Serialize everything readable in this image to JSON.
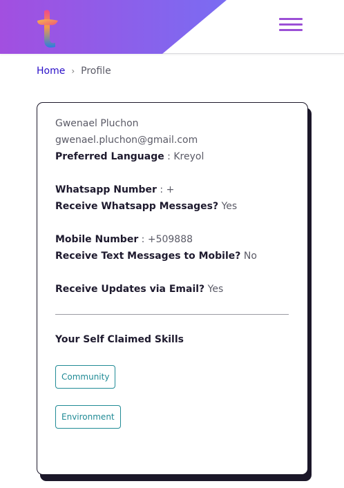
{
  "header": {
    "logo_icon": "t-logo-icon",
    "menu_icon": "hamburger-menu-icon",
    "gradient_from": "#a24fe0",
    "gradient_to": "#7a6cf2",
    "menu_color": "#9b4fd6"
  },
  "breadcrumb": {
    "home": "Home",
    "separator": "›",
    "current": "Profile"
  },
  "profile": {
    "name": "Gwenael Pluchon",
    "email": "gwenael.pluchon@gmail.com",
    "preferred_language_label": "Preferred Language",
    "preferred_language_value": " : Kreyol",
    "whatsapp_label": "Whatsapp Number",
    "whatsapp_value": " : +",
    "receive_whatsapp_label": "Receive Whatsapp Messages?",
    "receive_whatsapp_value": " Yes",
    "mobile_label": "Mobile Number",
    "mobile_value": " : +509888",
    "receive_text_label": "Receive Text Messages to Mobile?",
    "receive_text_value": " No",
    "receive_email_label": "Receive Updates via Email?",
    "receive_email_value": " Yes"
  },
  "skills": {
    "title": "Your Self Claimed Skills",
    "items": [
      "Community",
      "Environment"
    ],
    "tag_color": "#1f8a95"
  }
}
